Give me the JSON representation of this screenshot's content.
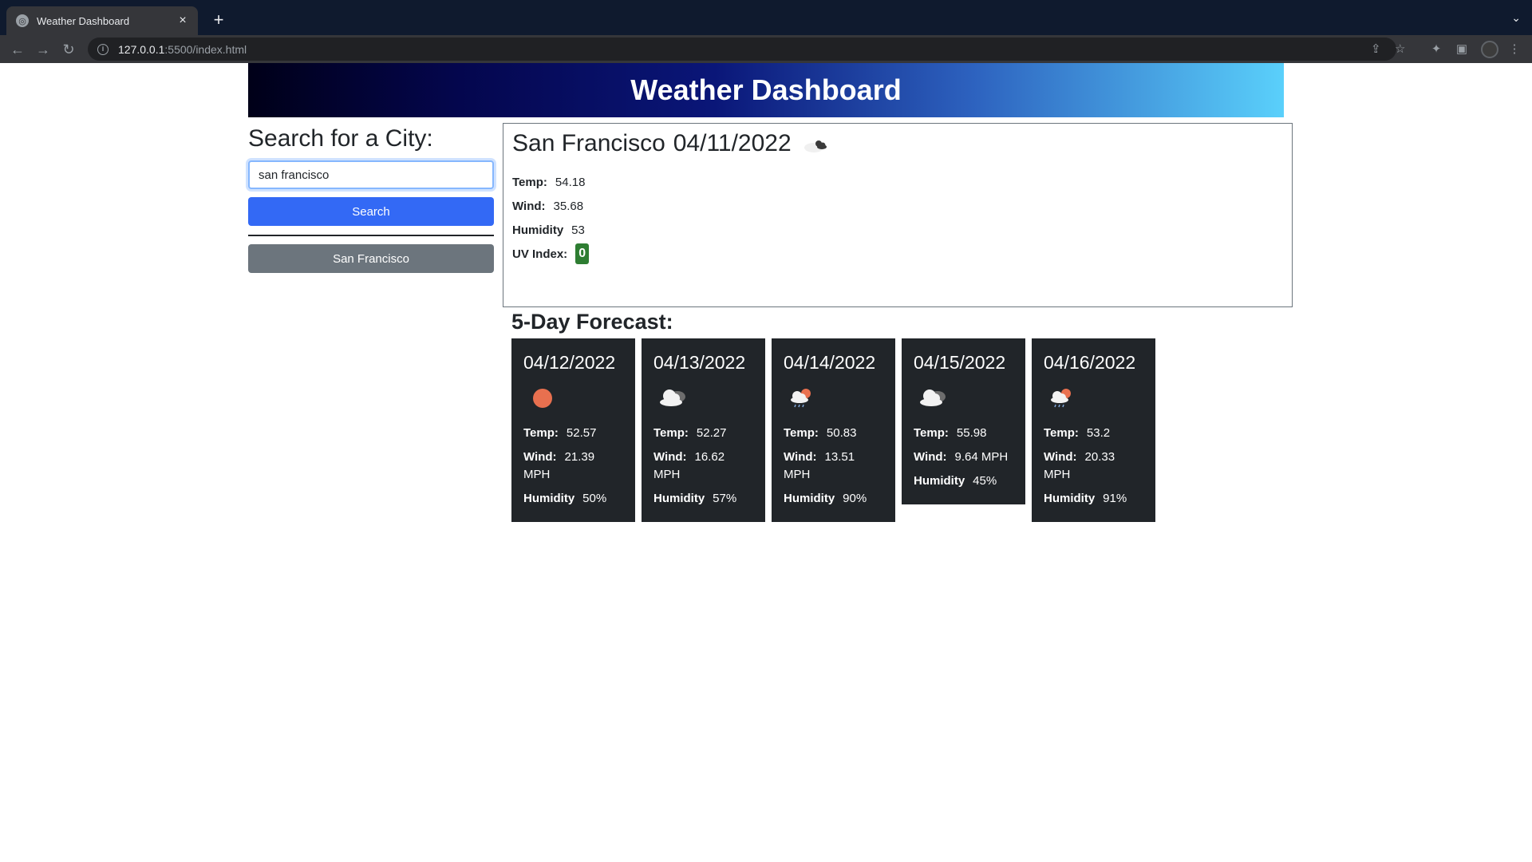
{
  "browser": {
    "tab_title": "Weather Dashboard",
    "tab_close": "×",
    "new_tab": "+",
    "url_host": "127.0.0.1",
    "url_rest": ":5500/index.html"
  },
  "header": {
    "title": "Weather Dashboard"
  },
  "sidebar": {
    "search_title": "Search for a City:",
    "search_value": "san francisco",
    "search_button": "Search",
    "history": [
      "San Francisco"
    ]
  },
  "current": {
    "city": "San Francisco",
    "date": "04/11/2022",
    "icon": "broken-clouds-icon",
    "temp_label": "Temp:",
    "temp": "54.18",
    "wind_label": "Wind:",
    "wind": "35.68",
    "humidity_label": "Humidity",
    "humidity": "53",
    "uv_label": "UV Index:",
    "uv": "0",
    "uv_color": "#2e7d32"
  },
  "forecast": {
    "title": "5-Day Forecast:",
    "days": [
      {
        "date": "04/12/2022",
        "icon": "clear-sky-icon",
        "temp_label": "Temp:",
        "temp": "52.57",
        "wind_label": "Wind:",
        "wind": "21.39 MPH",
        "humidity_label": "Humidity",
        "humidity": "50%"
      },
      {
        "date": "04/13/2022",
        "icon": "broken-clouds-icon",
        "temp_label": "Temp:",
        "temp": "52.27",
        "wind_label": "Wind:",
        "wind": "16.62 MPH",
        "humidity_label": "Humidity",
        "humidity": "57%"
      },
      {
        "date": "04/14/2022",
        "icon": "rain-sun-icon",
        "temp_label": "Temp:",
        "temp": "50.83",
        "wind_label": "Wind:",
        "wind": "13.51 MPH",
        "humidity_label": "Humidity",
        "humidity": "90%"
      },
      {
        "date": "04/15/2022",
        "icon": "broken-clouds-icon",
        "temp_label": "Temp:",
        "temp": "55.98",
        "wind_label": "Wind:",
        "wind": "9.64 MPH",
        "humidity_label": "Humidity",
        "humidity": "45%"
      },
      {
        "date": "04/16/2022",
        "icon": "rain-sun-icon",
        "temp_label": "Temp:",
        "temp": "53.2",
        "wind_label": "Wind:",
        "wind": "20.33 MPH",
        "humidity_label": "Humidity",
        "humidity": "91%"
      }
    ]
  },
  "colors": {
    "search_button": "#3369f5",
    "history_button": "#6c757d",
    "card_bg": "#212529",
    "sun": "#e8704f"
  }
}
